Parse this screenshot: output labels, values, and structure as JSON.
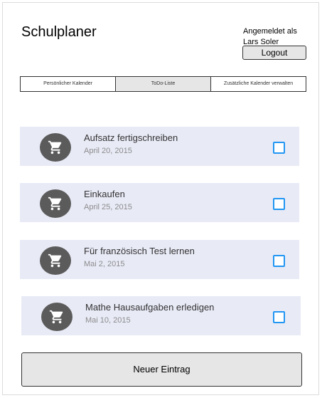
{
  "header": {
    "title": "Schulplaner",
    "logged_in_line1": "Angemeldet als",
    "logged_in_line2": "Lars Soler",
    "logout_label": "Logout"
  },
  "tabs": [
    {
      "label": "Persönlicher Kalender",
      "active": false
    },
    {
      "label": "ToDo-Liste",
      "active": true
    },
    {
      "label": "Zusätzliche Kalender verwalten",
      "active": false
    }
  ],
  "todos": [
    {
      "title": "Aufsatz fertigschreiben",
      "date": "April 20, 2015",
      "icon": "cart-icon",
      "checked": false
    },
    {
      "title": "Einkaufen",
      "date": "April 25, 2015",
      "icon": "cart-icon",
      "checked": false
    },
    {
      "title": "Für französisch Test lernen",
      "date": "Mai 2, 2015",
      "icon": "cart-icon",
      "checked": false
    },
    {
      "title": "Mathe Hausaufgaben erledigen",
      "date": "Mai 10, 2015",
      "icon": "cart-icon",
      "checked": false
    }
  ],
  "new_entry_label": "Neuer Eintrag",
  "colors": {
    "item_background": "#e8eaf6",
    "checkbox_accent": "#2196f3",
    "avatar_background": "#5b5b5b",
    "active_tab": "#e6e6e6"
  }
}
